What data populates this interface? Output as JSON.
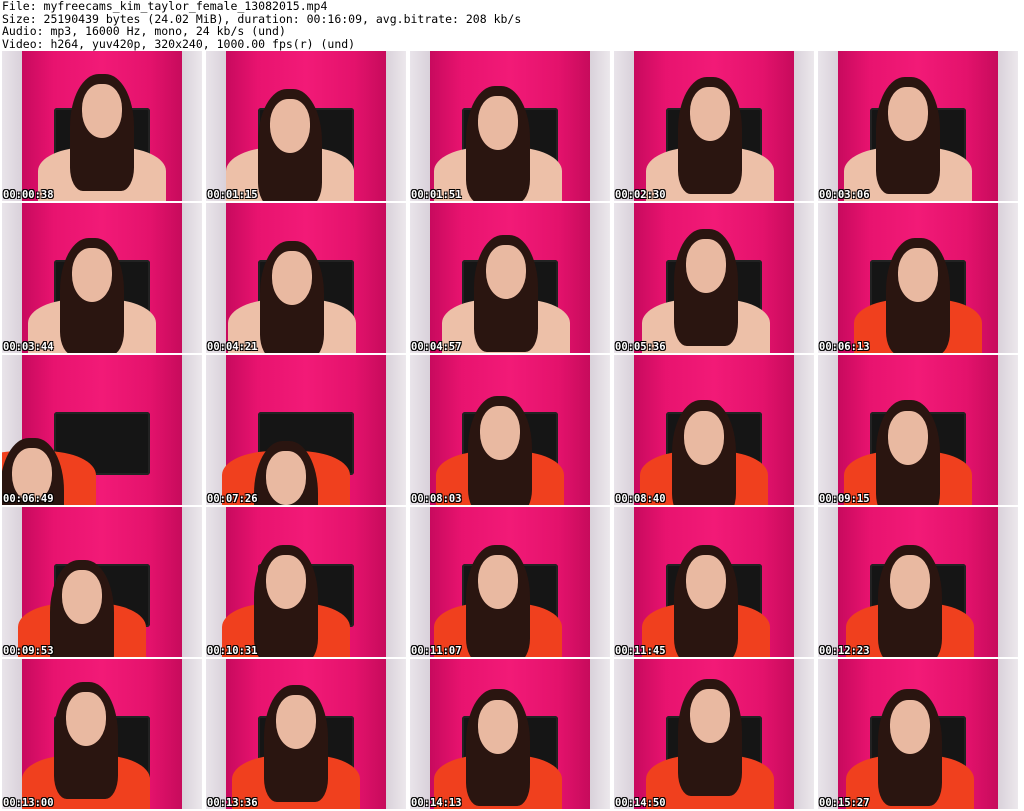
{
  "header": {
    "file_line": "File: myfreecams_kim_taylor_female_13082015.mp4",
    "size_line": "Size: 25190439 bytes (24.02 MiB), duration: 00:16:09, avg.bitrate: 208 kb/s",
    "audio_line": "Audio: mp3, 16000 Hz, mono, 24 kb/s (und)",
    "video_line": "Video: h264, yuv420p, 320x240, 1000.00 fps(r) (und)"
  },
  "thumbnails": [
    {
      "time": "00:00:38",
      "top": "skin"
    },
    {
      "time": "00:01:15",
      "top": "skin"
    },
    {
      "time": "00:01:51",
      "top": "skin"
    },
    {
      "time": "00:02:30",
      "top": "skin"
    },
    {
      "time": "00:03:06",
      "top": "skin"
    },
    {
      "time": "00:03:44",
      "top": "skin"
    },
    {
      "time": "00:04:21",
      "top": "skin"
    },
    {
      "time": "00:04:57",
      "top": "skin"
    },
    {
      "time": "00:05:36",
      "top": "skin"
    },
    {
      "time": "00:06:13",
      "top": "red"
    },
    {
      "time": "00:06:49",
      "top": "red"
    },
    {
      "time": "00:07:26",
      "top": "red"
    },
    {
      "time": "00:08:03",
      "top": "red"
    },
    {
      "time": "00:08:40",
      "top": "red"
    },
    {
      "time": "00:09:15",
      "top": "red"
    },
    {
      "time": "00:09:53",
      "top": "red"
    },
    {
      "time": "00:10:31",
      "top": "red"
    },
    {
      "time": "00:11:07",
      "top": "red"
    },
    {
      "time": "00:11:45",
      "top": "red"
    },
    {
      "time": "00:12:23",
      "top": "red"
    },
    {
      "time": "00:13:00",
      "top": "red"
    },
    {
      "time": "00:13:36",
      "top": "red"
    },
    {
      "time": "00:14:13",
      "top": "red"
    },
    {
      "time": "00:14:50",
      "top": "red"
    },
    {
      "time": "00:15:27",
      "top": "red"
    }
  ],
  "colors": {
    "curtain": "#e8136f",
    "wall": "#e6e2e6",
    "headboard": "#151515",
    "red_top": "#f0401e"
  }
}
